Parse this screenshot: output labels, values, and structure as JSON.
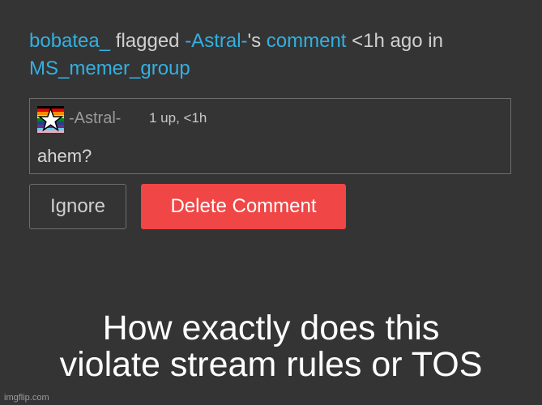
{
  "notification": {
    "actor": "bobatea_",
    "action": " flagged ",
    "target_user": "-Astral-",
    "possessive": "'s ",
    "object": "comment",
    "time_text": " <1h ago in ",
    "group": "MS_memer_group"
  },
  "comment": {
    "avatar_icon": "rainbow-star-avatar",
    "username": "-Astral-",
    "meta": "1 up, <1h",
    "text": "ahem?"
  },
  "actions": {
    "ignore_label": "Ignore",
    "delete_label": "Delete Comment"
  },
  "caption": {
    "line1": "How exactly does this",
    "line2": "violate stream rules or TOS"
  },
  "watermark": "imgflip.com",
  "colors": {
    "background": "#343434",
    "link": "#33b0e0",
    "delete_button": "#f04646",
    "border": "#6e6e6e"
  }
}
